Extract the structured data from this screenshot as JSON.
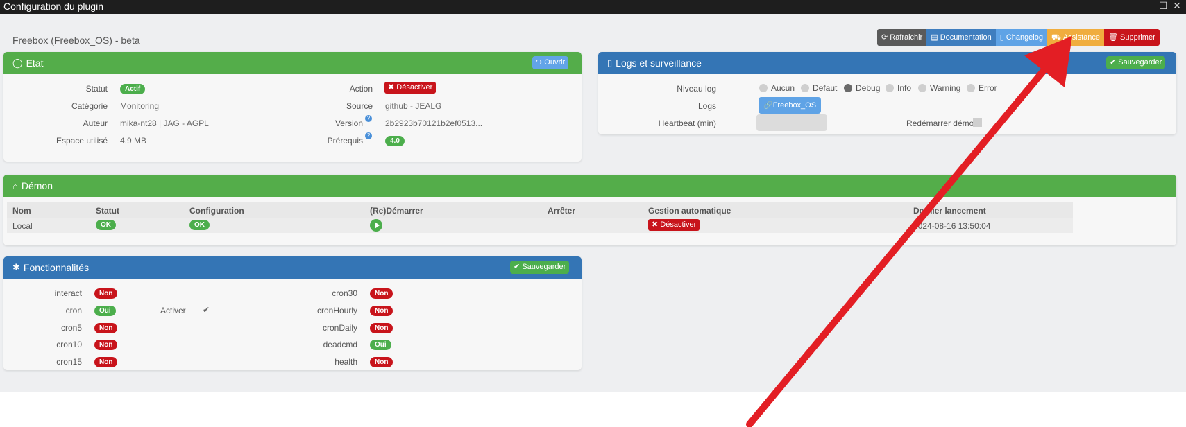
{
  "window": {
    "title": "Configuration du plugin",
    "maximize_icon": "square-icon",
    "close_icon": "x-icon"
  },
  "plugin": {
    "title": "Freebox (Freebox_OS) - beta"
  },
  "toolbar": {
    "refresh": "Rafraichir",
    "documentation": "Documentation",
    "changelog": "Changelog",
    "assistance": "Assistance",
    "delete": "Supprimer"
  },
  "etat": {
    "title": "Etat",
    "open_button": "Ouvrir",
    "statut_label": "Statut",
    "statut_value": "Actif",
    "categorie_label": "Catégorie",
    "categorie_value": "Monitoring",
    "auteur_label": "Auteur",
    "auteur_value": "mika-nt28 | JAG - AGPL",
    "espace_label": "Espace utilisé",
    "espace_value": "4.9 MB",
    "action_label": "Action",
    "action_button": "Désactiver",
    "source_label": "Source",
    "source_value": "github - JEALG",
    "version_label": "Version",
    "version_value": "2b2923b70121b2ef0513...",
    "prerequis_label": "Prérequis",
    "prerequis_value": "4.0"
  },
  "logs": {
    "title": "Logs et surveillance",
    "save_button": "Sauvegarder",
    "niveau_label": "Niveau log",
    "levels": [
      "Aucun",
      "Defaut",
      "Debug",
      "Info",
      "Warning",
      "Error"
    ],
    "selected_level": "Debug",
    "logs_label": "Logs",
    "log_button": "Freebox_OS",
    "heartbeat_label": "Heartbeat (min)",
    "heartbeat_value": "",
    "restart_label": "Redémarrer démon"
  },
  "demon": {
    "title": "Démon",
    "columns": [
      "Nom",
      "Statut",
      "Configuration",
      "(Re)Démarrer",
      "Arrêter",
      "Gestion automatique",
      "Dernier lancement"
    ],
    "row": {
      "nom": "Local",
      "statut": "OK",
      "configuration": "OK",
      "gestion": "Désactiver",
      "dernier": "2024-08-16 13:50:04"
    }
  },
  "fonctionnalites": {
    "title": "Fonctionnalités",
    "save_button": "Sauvegarder",
    "activer_label": "Activer",
    "left": [
      {
        "name": "interact",
        "value": "Non"
      },
      {
        "name": "cron",
        "value": "Oui"
      },
      {
        "name": "cron5",
        "value": "Non"
      },
      {
        "name": "cron10",
        "value": "Non"
      },
      {
        "name": "cron15",
        "value": "Non"
      }
    ],
    "right": [
      {
        "name": "cron30",
        "value": "Non"
      },
      {
        "name": "cronHourly",
        "value": "Non"
      },
      {
        "name": "cronDaily",
        "value": "Non"
      },
      {
        "name": "deadcmd",
        "value": "Oui"
      },
      {
        "name": "health",
        "value": "Non"
      }
    ]
  },
  "annotation": {
    "color": "#e31e24"
  }
}
